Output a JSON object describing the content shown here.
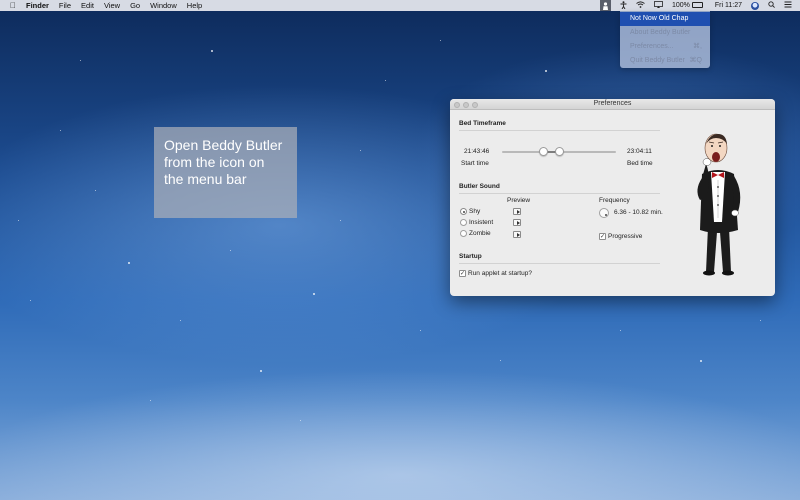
{
  "menubar": {
    "apple": "",
    "items": [
      "Finder",
      "File",
      "Edit",
      "View",
      "Go",
      "Window",
      "Help"
    ],
    "battery_percent": "100%",
    "clock": "Fri 11:27"
  },
  "dropdown": {
    "items": [
      {
        "label": "Not Now Old Chap",
        "shortcut": "",
        "active": true
      },
      {
        "label": "About Beddy Butler",
        "shortcut": "",
        "active": false
      },
      {
        "label": "Preferences...",
        "shortcut": "⌘,",
        "active": false
      },
      {
        "label": "Quit Beddy Butler",
        "shortcut": "⌘Q",
        "active": false
      }
    ]
  },
  "callout": {
    "text": "Open Beddy Butler from the icon on the menu bar"
  },
  "prefs": {
    "window_title": "Preferences",
    "bed_timeframe": {
      "title": "Bed Timeframe",
      "start_value": "21:43:46",
      "end_value": "23:04:11",
      "start_label": "Start time",
      "end_label": "Bed time",
      "range_start_fraction": 0.36,
      "range_end_fraction": 0.5
    },
    "butler_sound": {
      "title": "Butler Sound",
      "preview_label": "Preview",
      "options": [
        {
          "label": "Shy",
          "selected": true
        },
        {
          "label": "Insistent",
          "selected": false
        },
        {
          "label": "Zombie",
          "selected": false
        }
      ],
      "frequency_label": "Frequency",
      "frequency_value": "6.36 - 10.82 min.",
      "progressive_label": "Progressive",
      "progressive_checked": true
    },
    "startup": {
      "title": "Startup",
      "run_at_startup_label": "Run applet at startup?",
      "run_at_startup_checked": true
    }
  },
  "colors": {
    "menu_highlight": "#1f4fb0",
    "window_bg": "#ececec"
  }
}
